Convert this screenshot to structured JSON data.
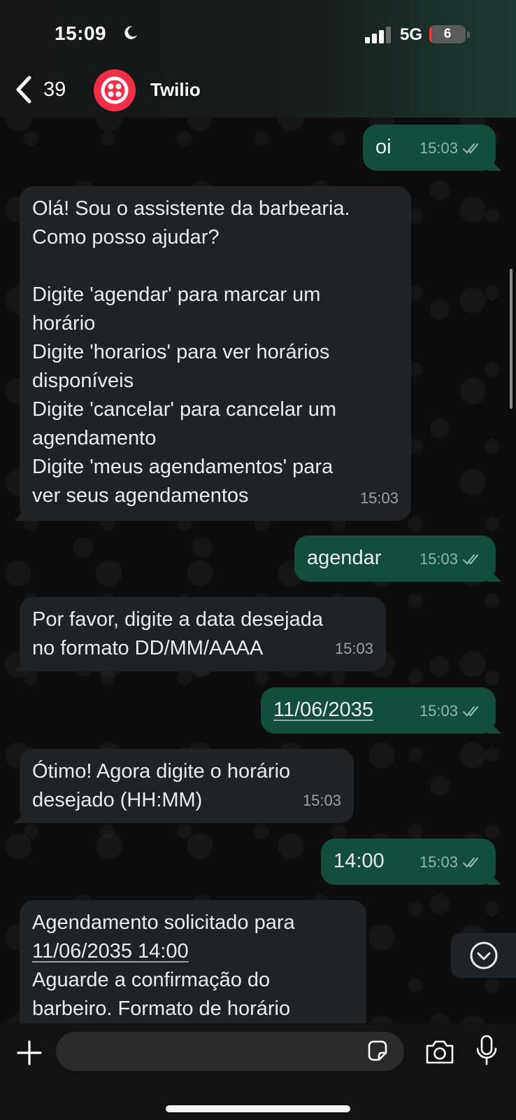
{
  "status_bar": {
    "time": "15:09",
    "network": "5G",
    "battery_level": "6",
    "battery_fraction": 0.06
  },
  "header": {
    "back_count": "39",
    "contact_name": "Twilio",
    "avatar_icon": "twilio-logo-icon",
    "avatar_color": "#f22f46"
  },
  "messages": [
    {
      "direction": "out",
      "text": "oi",
      "time": "15:03",
      "status": "read"
    },
    {
      "direction": "in",
      "text": "Olá! Sou o assistente da barbearia.\nComo posso ajudar?\n\nDigite 'agendar' para marcar um\nhorário\nDigite 'horarios' para ver horários\ndisponíveis\nDigite 'cancelar' para cancelar um\nagendamento\nDigite 'meus agendamentos' para\nver seus agendamentos",
      "time": "15:03"
    },
    {
      "direction": "out",
      "text": "agendar",
      "time": "15:03",
      "status": "read"
    },
    {
      "direction": "in",
      "text": "Por favor, digite a data desejada\nno formato DD/MM/AAAA",
      "time": "15:03"
    },
    {
      "direction": "out",
      "text": "11/06/2035",
      "time": "15:03",
      "status": "read"
    },
    {
      "direction": "in",
      "text": "Ótimo! Agora digite o horário\ndesejado (HH:MM)",
      "time": "15:03"
    },
    {
      "direction": "out",
      "text": "14:00",
      "time": "15:03",
      "status": "read"
    },
    {
      "direction": "in",
      "text_line1": "Agendamento solicitado para",
      "text_link": "11/06/2035 14:00",
      "text_rest": "Aguarde a confirmação do\nbarbeiro. Formato de horário"
    }
  ],
  "composer": {
    "placeholder": "",
    "icons": [
      "plus-icon",
      "sticker-icon",
      "camera-icon",
      "microphone-icon"
    ]
  },
  "colors": {
    "incoming_bubble": "#1f2326",
    "outgoing_bubble": "#134d3b",
    "read_ticks": "#8fb7ab"
  }
}
